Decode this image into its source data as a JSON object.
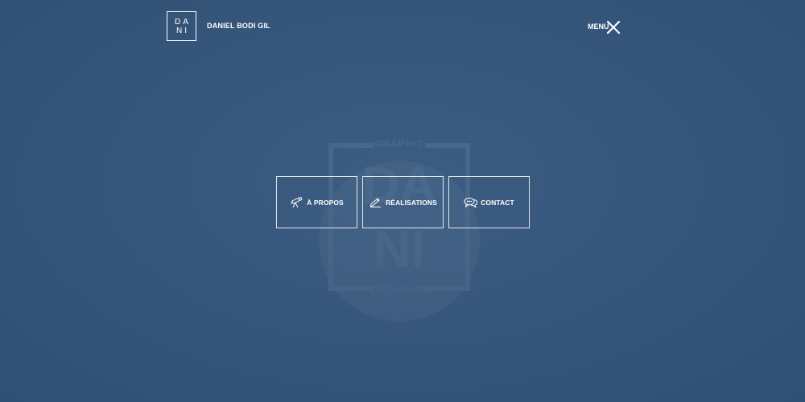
{
  "header": {
    "logo_line1": "DA",
    "logo_line2": "NI",
    "brand_name": "DANIEL BODI GIL",
    "menu_label": "MENU"
  },
  "watermark": {
    "top_text": "GRAPHIC",
    "letters_line1": "DA",
    "letters_line2": "NI",
    "bottom_text": "DESIGNER"
  },
  "menu": {
    "items": [
      {
        "label": "À PROPOS",
        "icon": "telescope-icon"
      },
      {
        "label": "RÉALISATIONS",
        "icon": "pencil-ruler-icon"
      },
      {
        "label": "CONTACT",
        "icon": "chat-bubbles-icon"
      }
    ]
  },
  "colors": {
    "background": "#35557a",
    "foreground": "#ffffff"
  }
}
